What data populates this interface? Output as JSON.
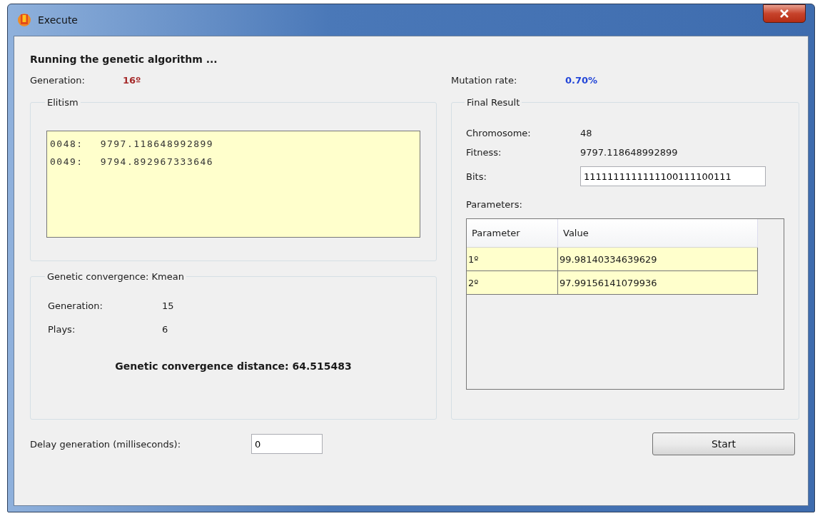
{
  "window": {
    "title": "Execute"
  },
  "heading": "Running the genetic algorithm ...",
  "generation": {
    "label": "Generation:",
    "value": "16º"
  },
  "mutation_rate": {
    "label": "Mutation rate:",
    "value": "0.70%"
  },
  "elitism": {
    "title": "Elitism",
    "lines": [
      {
        "index": "0048:",
        "value": "9797.118648992899"
      },
      {
        "index": "0049:",
        "value": "9794.892967333646"
      }
    ]
  },
  "convergence": {
    "title": "Genetic convergence: Kmean",
    "fields": [
      {
        "label": "Generation:",
        "value": "15"
      },
      {
        "label": "Plays:",
        "value": "6"
      }
    ],
    "distance": "Genetic convergence distance: 64.515483"
  },
  "final_result": {
    "title": "Final Result",
    "fields": [
      {
        "label": "Chromosome:",
        "value": "48"
      },
      {
        "label": "Fitness:",
        "value": "9797.118648992899"
      }
    ],
    "bits": {
      "label": "Bits:",
      "value": "1111111111111100111100111"
    },
    "parameters_label": "Parameters:",
    "table": {
      "columns": [
        "Parameter",
        "Value"
      ],
      "rows": [
        [
          "1º",
          "99.98140334639629"
        ],
        [
          "2º",
          "97.99156141079936"
        ]
      ]
    }
  },
  "delay": {
    "label": "Delay generation (milliseconds):",
    "value": "0"
  },
  "buttons": [
    "Start"
  ]
}
